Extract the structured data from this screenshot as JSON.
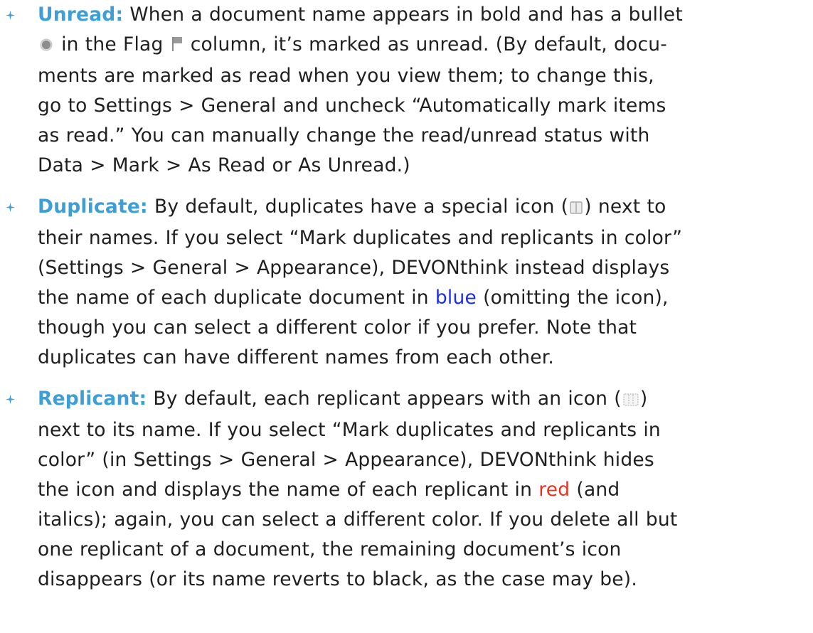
{
  "items": [
    {
      "term": "Unread:",
      "lines": [
        " When a document name appears in bold and has a bullet",
        [
          "",
          "radio-bullet-icon",
          " in the Flag ",
          "flag-icon",
          " column, it’s marked as unread. (By default, docu-"
        ],
        "ments are marked as read when you view them; to change this,",
        "go to Settings > General and uncheck “Automatically mark items",
        "as read.” You can manually change the read/unread status with",
        "Data > Mark > As Read or As Unread.)"
      ]
    },
    {
      "term": "Duplicate:",
      "line1_pre": " By default, duplicates have a special icon (",
      "line1_post": ") next to",
      "lines_after": [
        "their names. If you select “Mark duplicates and replicants in color”",
        "(Settings > General > Appearance), DEVONthink instead displays"
      ],
      "line4_pre": "the name of each duplicate document in ",
      "line4_color_word": "blue",
      "line4_post": " (omitting the icon),",
      "lines_end": [
        "though you can select a different color if you prefer. Note that",
        "duplicates can have different names from each other."
      ]
    },
    {
      "term": "Replicant:",
      "line1_pre": " By default, each replicant appears with an icon (",
      "line1_post": ")",
      "lines_after": [
        "next to its name. If you select “Mark duplicates and replicants in",
        "color” (in Settings > General > Appearance), DEVONthink hides"
      ],
      "line4_pre": "the icon and displays the name of each replicant in ",
      "line4_color_word": "red",
      "line4_post": " (and",
      "lines_end": [
        "italics); again, you can select a different color. If you delete all but",
        "one replicant of a document, the remaining document’s icon",
        "disappears (or its name reverts to black, as the case may be)."
      ]
    }
  ],
  "colors": {
    "term": "#3e9fd6",
    "duplicate_color_word": "#1b2cf0",
    "replicant_color_word": "#e8321e",
    "bullet": "#3e9fd6",
    "text": "#1f1f1f"
  },
  "icons": {
    "list_bullet": "four-point-star-bullet-icon",
    "unread_marker": "radio-bullet-icon",
    "flag": "flag-icon",
    "duplicate": "duplicate-icon",
    "replicant": "replicant-icon"
  }
}
